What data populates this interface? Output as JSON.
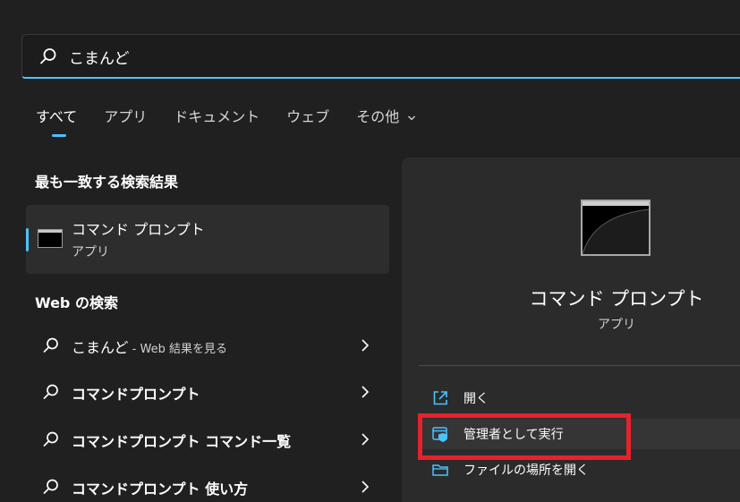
{
  "search": {
    "value": "こまんど"
  },
  "tabs": [
    {
      "label": "すべて"
    },
    {
      "label": "アプリ"
    },
    {
      "label": "ドキュメント"
    },
    {
      "label": "ウェブ"
    },
    {
      "label": "その他"
    }
  ],
  "best_match": {
    "heading": "最も一致する検索結果",
    "title": "コマンド プロンプト",
    "subtitle": "アプリ"
  },
  "web_search": {
    "heading": "Web の検索",
    "items": [
      {
        "label": "こまんど",
        "suffix": " - Web 結果を見る"
      },
      {
        "label": "コマンドプロンプト"
      },
      {
        "label": "コマンドプロンプト コマンド一覧"
      },
      {
        "label": "コマンドプロンプト 使い方"
      }
    ]
  },
  "details": {
    "title": "コマンド プロンプト",
    "type": "アプリ",
    "actions": [
      {
        "label": "開く",
        "icon": "open-external-icon"
      },
      {
        "label": "管理者として実行",
        "icon": "run-as-admin-shield-icon"
      },
      {
        "label": "ファイルの場所を開く",
        "icon": "folder-icon"
      }
    ]
  },
  "colors": {
    "accent": "#4cc2ff",
    "highlight_box": "#e6222d",
    "background": "#202020"
  }
}
